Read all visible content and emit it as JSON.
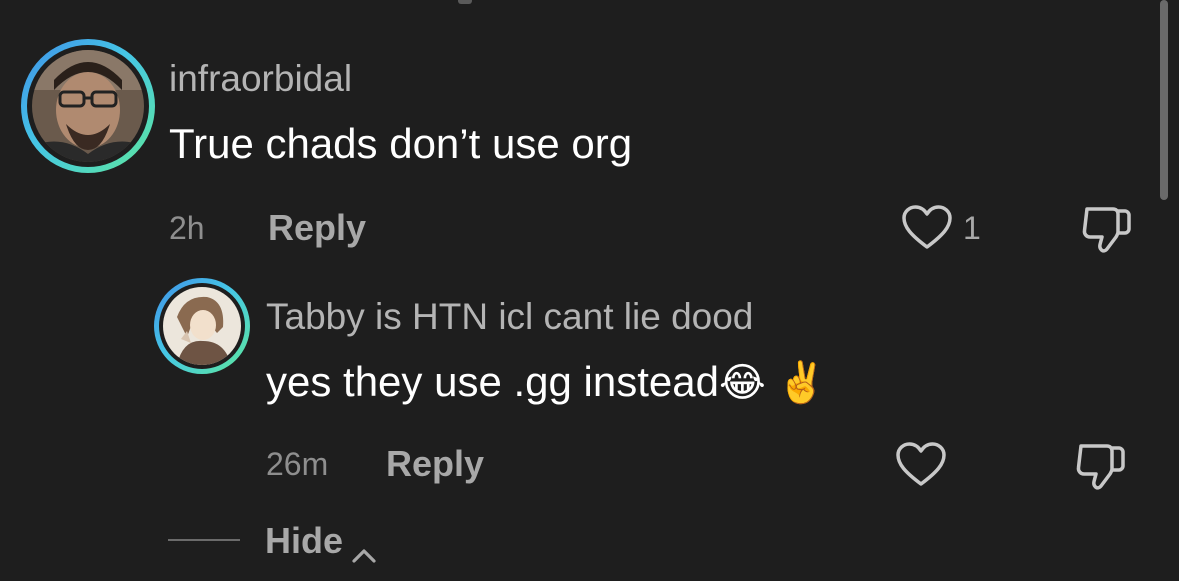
{
  "thread": {
    "comment": {
      "username": "infraorbidal",
      "text": "True chads don’t use org",
      "time": "2h",
      "reply_label": "Reply",
      "like_count": "1"
    },
    "reply": {
      "username": "Tabby is HTN icl cant lie dood",
      "text": "yes they use .gg instead",
      "emoji": "😂 ✌️",
      "time": "26m",
      "reply_label": "Reply"
    },
    "hide_label": "Hide"
  },
  "icons": {
    "like": "heart-outline-icon",
    "dislike": "thumbs-down-outline-icon",
    "collapse": "chevron-up-icon"
  },
  "colors": {
    "background": "#1e1e1e",
    "avatar_ring_start": "#3f8fe8",
    "avatar_ring_end": "#5ee79c"
  }
}
